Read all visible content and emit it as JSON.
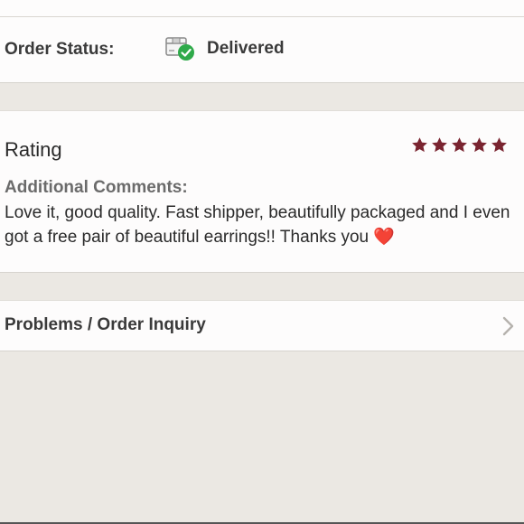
{
  "order": {
    "status_label": "Order Status:",
    "status_value": "Delivered",
    "status_icon": "delivered-box-icon"
  },
  "rating": {
    "title": "Rating",
    "stars": 5,
    "star_color": "#7a2430",
    "comments_label": "Additional Comments:",
    "comments_text": "Love it, good quality. Fast shipper, beautifully packaged and I even got a free pair of beautiful earrings!! Thanks you",
    "comments_emoji": "❤️"
  },
  "inquiry": {
    "label": "Problems / Order Inquiry",
    "chevron_icon": "chevron-right-icon"
  },
  "colors": {
    "background": "#ebe8e3",
    "card": "#fdfcfc",
    "check_green": "#2faa4a",
    "heart_red": "#d8232a"
  }
}
